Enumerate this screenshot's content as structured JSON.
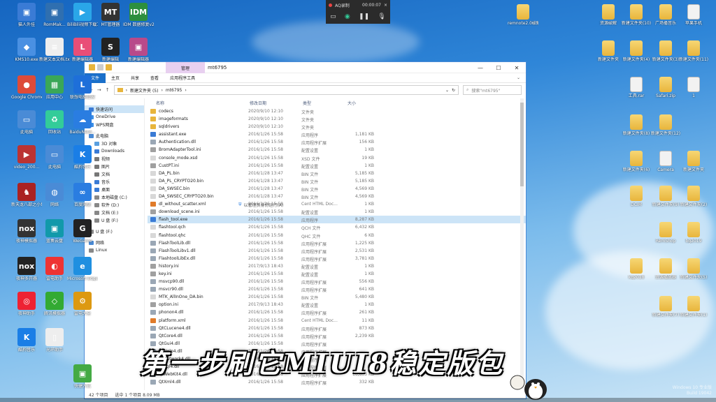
{
  "recorder": {
    "title": "AQ录制",
    "time": "00:00:07"
  },
  "desktop_left": [
    {
      "label": "猫人外挂",
      "color": "#3a7bd5",
      "glyph": "▣"
    },
    {
      "label": "RomMak...",
      "color": "#2f6fb0",
      "glyph": "▣"
    },
    {
      "label": "BiliBili视频下载工具V1.5...",
      "color": "#2aa6e8",
      "glyph": "▶"
    },
    {
      "label": "MT管理器",
      "color": "#333",
      "glyph": "MT"
    },
    {
      "label": "IDM 数据修复v2.0破...",
      "color": "#2d8f3f",
      "glyph": "IDM"
    },
    {
      "label": "KMS10.exe",
      "color": "#4a90e2",
      "glyph": "◆"
    },
    {
      "label": "新建文本文档.txt",
      "color": "#eee",
      "glyph": "≡"
    },
    {
      "label": "新建编辑器",
      "color": "#e94e77",
      "glyph": "L"
    },
    {
      "label": "新建编辑",
      "color": "#222",
      "glyph": "S"
    },
    {
      "label": "新建编辑器",
      "color": "#b84a8a",
      "glyph": "▣"
    },
    {
      "label": "Google Chrome",
      "color": "#dd4b39",
      "glyph": "●"
    },
    {
      "label": "应用中心",
      "color": "#3aa757",
      "glyph": "▦"
    },
    {
      "label": "联想电脑管家",
      "color": "#1e6fd9",
      "glyph": "L"
    },
    {
      "label": "此电脑",
      "color": "#4a8bd6",
      "glyph": "▭"
    },
    {
      "label": "回收站",
      "color": "#3c9",
      "glyph": "♻"
    },
    {
      "label": "BaiduNetd...",
      "color": "#2a7de1",
      "glyph": "☁"
    },
    {
      "label": "video_200...",
      "color": "#b33",
      "glyph": "▶"
    },
    {
      "label": "此电脑",
      "color": "#4a8bd6",
      "glyph": "▭"
    },
    {
      "label": "酷狗音乐",
      "color": "#1a7ee6",
      "glyph": "K"
    },
    {
      "label": "新天龙八部之小世界模拟器",
      "color": "#a22",
      "glyph": "♞"
    },
    {
      "label": "网络",
      "color": "#4a8bd6",
      "glyph": "◍"
    },
    {
      "label": "百度网盘",
      "color": "#2a7de1",
      "glyph": "∞"
    },
    {
      "label": "夜神模拟器",
      "color": "#333",
      "glyph": "nox"
    },
    {
      "label": "蓝奏云盘",
      "color": "#19a",
      "glyph": "▣"
    },
    {
      "label": "WeGame",
      "color": "#222",
      "glyph": "G"
    },
    {
      "label": "夜神多开器",
      "color": "#222",
      "glyph": "nox"
    },
    {
      "label": "雷电助手",
      "color": "#e33",
      "glyph": "◐"
    },
    {
      "label": "Microsoft Edge",
      "color": "#1f8fe0",
      "glyph": "e"
    },
    {
      "label": "夜神助手",
      "color": "#e23",
      "glyph": "◎"
    },
    {
      "label": "腾讯模拟器",
      "color": "#3a3",
      "glyph": "◇"
    },
    {
      "label": "雷电大全",
      "color": "#d91",
      "glyph": "⚙"
    },
    {
      "label": "酷狗音乐",
      "color": "#1a7ee6",
      "glyph": "K"
    },
    {
      "label": "光环助手",
      "color": "#eee",
      "glyph": "▯"
    },
    {
      "label": "快捷方式",
      "color": "#4a4",
      "glyph": "▣"
    }
  ],
  "desktop_right": [
    {
      "label": "remnote2.0破解",
      "type": "folder"
    },
    {
      "label": "资源破解",
      "type": "folder"
    },
    {
      "label": "新建文件夹(10)",
      "type": "folder"
    },
    {
      "label": "广场播音乐",
      "type": "folder"
    },
    {
      "label": "苹果手机",
      "type": "file"
    },
    {
      "label": "新建文件夹",
      "type": "folder"
    },
    {
      "label": "新建文件夹(4)",
      "type": "folder"
    },
    {
      "label": "新建文件夹(3)",
      "type": "folder"
    },
    {
      "label": "新建文件夹(11)",
      "type": "folder"
    },
    {
      "label": "工具.rar",
      "type": "file"
    },
    {
      "label": "Safari.zip",
      "type": "folder"
    },
    {
      "label": "1",
      "type": "file"
    },
    {
      "label": "新建文件夹(8)",
      "type": "folder"
    },
    {
      "label": "新建文件夹(12)",
      "type": "folder"
    },
    {
      "label": "新建文件夹(6)",
      "type": "folder"
    },
    {
      "label": "Camera",
      "type": "file"
    },
    {
      "label": "新建文件夹",
      "type": "folder"
    },
    {
      "label": "DCIM",
      "type": "folder"
    },
    {
      "label": "新建文件夹(9)",
      "type": "folder"
    },
    {
      "label": "新建文件夹(2)",
      "type": "folder"
    },
    {
      "label": "RemShop",
      "type": "folder"
    },
    {
      "label": "bg2019",
      "type": "folder"
    },
    {
      "label": "kq2018",
      "type": "folder"
    },
    {
      "label": "资源播放器",
      "type": "folder"
    },
    {
      "label": "新建文件夹(5)",
      "type": "folder"
    },
    {
      "label": "新建文件夹(7)",
      "type": "folder"
    },
    {
      "label": "新建文件夹(1)",
      "type": "folder"
    }
  ],
  "explorer": {
    "manage_tab": "管理",
    "title": "mt6795",
    "ribbon": [
      "文件",
      "主页",
      "共享",
      "查看",
      "应用程序工具"
    ],
    "path": [
      "新建文件夹 (5)",
      "mt6795"
    ],
    "search_placeholder": "搜索\"mt6795\"",
    "context_hint": "以管理员身份运行(A)",
    "columns": {
      "name": "名称",
      "date": "修改日期",
      "type": "类型",
      "size": "大小"
    },
    "nav": [
      {
        "label": "快速访问",
        "color": "#3a7bd5"
      },
      {
        "label": "OneDrive",
        "color": "#3a8ee6"
      },
      {
        "label": "WPS网盘",
        "color": "#3a8ee6"
      },
      {
        "label": "此电脑",
        "color": "#4a8bd6"
      },
      {
        "label": "3D 对象",
        "color": "#5aa0e0"
      },
      {
        "label": "Downloads",
        "color": "#3a7bd5"
      },
      {
        "label": "视频",
        "color": "#777"
      },
      {
        "label": "图片",
        "color": "#777"
      },
      {
        "label": "文档",
        "color": "#777"
      },
      {
        "label": "音乐",
        "color": "#3a7bd5"
      },
      {
        "label": "桌面",
        "color": "#3a7bd5"
      },
      {
        "label": "本地磁盘 (C:)",
        "color": "#888"
      },
      {
        "label": "软件 (D:)",
        "color": "#888"
      },
      {
        "label": "文档 (E:)",
        "color": "#888"
      },
      {
        "label": "U 盘 (F:)",
        "color": "#888"
      },
      {
        "label": "U 盘 (F:)",
        "color": "#888"
      },
      {
        "label": "网络",
        "color": "#4a8bd6"
      },
      {
        "label": "Linux",
        "color": "#888"
      }
    ],
    "files": [
      {
        "name": "codecs",
        "date": "2020/9/10 12:10",
        "type": "文件夹",
        "size": "",
        "icon": "folder"
      },
      {
        "name": "imageformats",
        "date": "2020/9/10 12:10",
        "type": "文件夹",
        "size": "",
        "icon": "folder"
      },
      {
        "name": "sqldrivers",
        "date": "2020/9/10 12:10",
        "type": "文件夹",
        "size": "",
        "icon": "folder"
      },
      {
        "name": "assistant.exe",
        "date": "2016/1/26 15:58",
        "type": "应用程序",
        "size": "1,181 KB",
        "icon": "exe"
      },
      {
        "name": "Authentication.dll",
        "date": "2016/1/26 15:58",
        "type": "应用程序扩展",
        "size": "156 KB",
        "icon": "dll"
      },
      {
        "name": "BromAdapterTool.ini",
        "date": "2016/1/26 15:58",
        "type": "配置设置",
        "size": "1 KB",
        "icon": "ini"
      },
      {
        "name": "console_mode.xsd",
        "date": "2016/1/26 15:58",
        "type": "XSD 文件",
        "size": "19 KB",
        "icon": "file"
      },
      {
        "name": "CustPT.ini",
        "date": "2016/1/26 15:58",
        "type": "配置设置",
        "size": "1 KB",
        "icon": "ini"
      },
      {
        "name": "DA_PL.bin",
        "date": "2016/1/28 13:47",
        "type": "BIN 文件",
        "size": "5,185 KB",
        "icon": "file"
      },
      {
        "name": "DA_PL_CRYPTO20.bin",
        "date": "2016/1/28 13:47",
        "type": "BIN 文件",
        "size": "5,185 KB",
        "icon": "file"
      },
      {
        "name": "DA_SWSEC.bin",
        "date": "2016/1/28 13:47",
        "type": "BIN 文件",
        "size": "4,569 KB",
        "icon": "file"
      },
      {
        "name": "DA_SWSEC_CRYPTO20.bin",
        "date": "2016/1/28 13:47",
        "type": "BIN 文件",
        "size": "4,569 KB",
        "icon": "file"
      },
      {
        "name": "dl_without_scatter.xml",
        "date": "2016/1/26 15:58",
        "type": "Cent HTML Doc...",
        "size": "1 KB",
        "icon": "xml"
      },
      {
        "name": "download_scene.ini",
        "date": "2016/1/26 15:58",
        "type": "配置设置",
        "size": "1 KB",
        "icon": "ini"
      },
      {
        "name": "flash_tool.exe",
        "date": "2016/1/26 15:58",
        "type": "应用程序",
        "size": "8,287 KB",
        "icon": "exe",
        "selected": true
      },
      {
        "name": "flashtool.qch",
        "date": "2016/1/26 15:58",
        "type": "QCH 文件",
        "size": "6,432 KB",
        "icon": "file"
      },
      {
        "name": "flashtool.qhc",
        "date": "2016/1/26 15:58",
        "type": "QHC 文件",
        "size": "6 KB",
        "icon": "file"
      },
      {
        "name": "FlashToolLib.dll",
        "date": "2016/1/26 15:58",
        "type": "应用程序扩展",
        "size": "1,225 KB",
        "icon": "dll"
      },
      {
        "name": "FlashToolLibv1.dll",
        "date": "2016/1/26 15:58",
        "type": "应用程序扩展",
        "size": "2,531 KB",
        "icon": "dll"
      },
      {
        "name": "FlashtoolLibEx.dll",
        "date": "2016/1/26 15:58",
        "type": "应用程序扩展",
        "size": "3,781 KB",
        "icon": "dll"
      },
      {
        "name": "history.ini",
        "date": "2017/9/13 18:43",
        "type": "配置设置",
        "size": "1 KB",
        "icon": "ini"
      },
      {
        "name": "key.ini",
        "date": "2016/1/26 15:58",
        "type": "配置设置",
        "size": "1 KB",
        "icon": "ini"
      },
      {
        "name": "msvcp90.dll",
        "date": "2016/1/26 15:58",
        "type": "应用程序扩展",
        "size": "556 KB",
        "icon": "dll"
      },
      {
        "name": "msvcr90.dll",
        "date": "2016/1/26 15:58",
        "type": "应用程序扩展",
        "size": "641 KB",
        "icon": "dll"
      },
      {
        "name": "MTK_AllInOne_DA.bin",
        "date": "2016/1/26 15:58",
        "type": "BIN 文件",
        "size": "5,480 KB",
        "icon": "file"
      },
      {
        "name": "option.ini",
        "date": "2017/9/13 18:43",
        "type": "配置设置",
        "size": "1 KB",
        "icon": "ini"
      },
      {
        "name": "phonon4.dll",
        "date": "2016/1/26 15:58",
        "type": "应用程序扩展",
        "size": "261 KB",
        "icon": "dll"
      },
      {
        "name": "platform.xml",
        "date": "2016/1/26 15:58",
        "type": "Cent HTML Doc...",
        "size": "11 KB",
        "icon": "xml"
      },
      {
        "name": "QtCLucene4.dll",
        "date": "2016/1/26 15:58",
        "type": "应用程序扩展",
        "size": "873 KB",
        "icon": "dll"
      },
      {
        "name": "QtCore4.dll",
        "date": "2016/1/26 15:58",
        "type": "应用程序扩展",
        "size": "2,239 KB",
        "icon": "dll"
      },
      {
        "name": "QtGui4.dll",
        "date": "2016/1/26 15:58",
        "type": "应用程序扩展",
        "size": "",
        "icon": "dll"
      },
      {
        "name": "QtHelp4.dll",
        "date": "2016/1/26 15:58",
        "type": "应用程序扩展",
        "size": "",
        "icon": "dll"
      },
      {
        "name": "QtNetwork4.dll",
        "date": "2016/1/26 15:58",
        "type": "应用程序扩展",
        "size": "",
        "icon": "dll"
      },
      {
        "name": "QtSql4.dll",
        "date": "2016/1/26 15:58",
        "type": "应用程序扩展",
        "size": "",
        "icon": "dll"
      },
      {
        "name": "QtWebKit4.dll",
        "date": "2016/1/26 15:58",
        "type": "应用程序扩展",
        "size": "10,603 KB",
        "icon": "dll"
      },
      {
        "name": "QtXml4.dll",
        "date": "2016/1/26 15:58",
        "type": "应用程序扩展",
        "size": "332 KB",
        "icon": "dll"
      }
    ],
    "status_count": "42 个项目",
    "status_selected": "选中 1 个项目  8.09 MB"
  },
  "overlay_text": "第一步刷它MIUI8稳定版包",
  "watermark": [
    "Windows 10 专业版",
    "Build 19042"
  ],
  "icon_colors": {
    "folder": "#e8b53c",
    "exe": "#3a7bd5",
    "dll": "#9aa7b5",
    "ini": "#a0a0a0",
    "xml": "#e07b2a",
    "file": "#d8d8d8"
  }
}
